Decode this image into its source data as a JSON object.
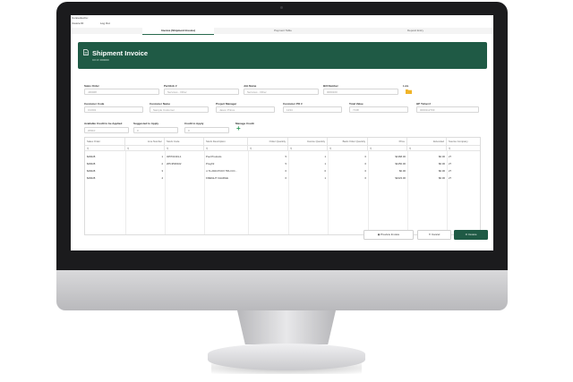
{
  "header": {
    "line1": "Connected to:",
    "user_short": "Invoice ID",
    "logout_label": "Log Out"
  },
  "tabs": [
    {
      "label": "Invoice (Shipment Invoice)",
      "active": true
    },
    {
      "label": "Payment Table",
      "active": false
    },
    {
      "label": "Deposit Entry",
      "active": false
    }
  ],
  "banner": {
    "title": "Shipment Invoice",
    "subtitle": "CO #: 000000",
    "color": "#1f5a45"
  },
  "form": {
    "sales_order": {
      "label": "Sales Order",
      "value": "J49028"
    },
    "purchase_no": {
      "label": "Part/Job #",
      "value": "Services - Other"
    },
    "job_name": {
      "label": "Job Name",
      "value": "Services - Other"
    },
    "bill_number": {
      "label": "Bill Number",
      "value": "0000100"
    },
    "lots": {
      "label": "Lots"
    },
    "customer_code": {
      "label": "Customer Code",
      "value": "CU001"
    },
    "customer_name": {
      "label": "Customer Name",
      "value": "Sample Customer"
    },
    "project_manager": {
      "label": "Project Manager",
      "value": "Jason Prince"
    },
    "customer_po": {
      "label": "Customer PO #",
      "value": "1234"
    },
    "total_value": {
      "label": "Total Value",
      "value": "7138"
    },
    "hp_ticket": {
      "label": "HP Ticket #",
      "value": "0000112703"
    },
    "available_credit": {
      "label": "Available Credit to be Applied",
      "value": "20910"
    },
    "suggested_apply": {
      "label": "Suggested to Apply",
      "value": "0"
    },
    "credit_apply": {
      "label": "Credit to Apply",
      "value": "0"
    },
    "manage_credit": {
      "label": "Manage Credit"
    }
  },
  "grid": {
    "columns": [
      "Sales Order",
      "Line Number",
      "Stock Code",
      "Stock Description",
      "Order Quantity",
      "Invoice Quantity",
      "Back Order Quantity",
      "Price",
      "Extended",
      "Source Company"
    ],
    "filter_icon": "search-icon",
    "rows": [
      [
        "$49028",
        "1",
        "325701301-1",
        "Pool Products",
        "5",
        "1",
        "0",
        "$1368.00",
        "$0.00",
        "27"
      ],
      [
        "$49028",
        "2",
        "205-9500102",
        "ProgX2",
        "5",
        "1",
        "0",
        "$1250.00",
        "$0.00",
        "27"
      ],
      [
        "$49028",
        "3",
        "",
        "J-71-2024 PCKX TRH CO...",
        "0",
        "0",
        "0",
        "$0.00",
        "$0.00",
        "27"
      ],
      [
        "$49028",
        "4",
        "",
        "FREIGHT CHARGE",
        "0",
        "1",
        "0",
        "$1023.00",
        "$0.00",
        "27"
      ]
    ]
  },
  "actions": {
    "preview": "Preview Invoice",
    "cancel": "Cancel",
    "invoice": "Invoice"
  }
}
